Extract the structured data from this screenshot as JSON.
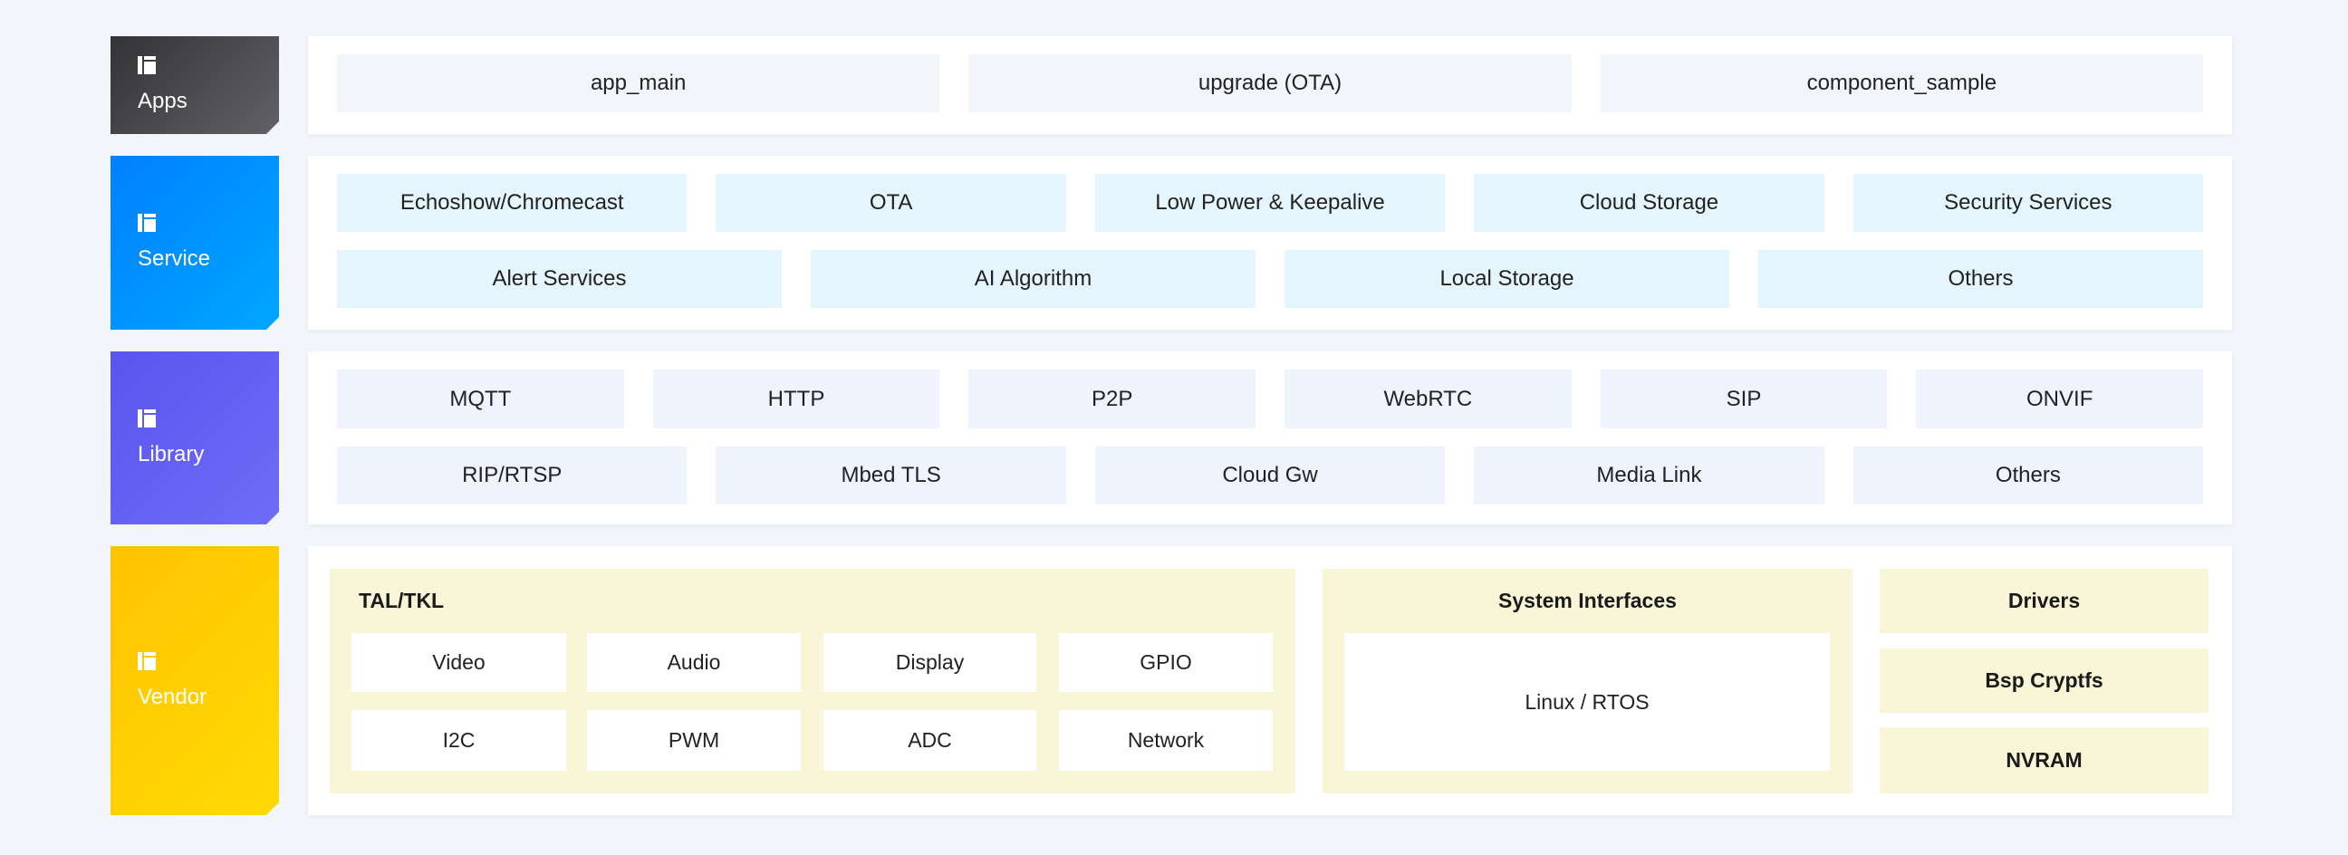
{
  "layers": [
    {
      "label": "Apps",
      "icon": "layout-icon",
      "color_start": "#333336",
      "color_end": "#626266"
    },
    {
      "label": "Service",
      "icon": "layout-icon",
      "color_start": "#0080ff",
      "color_end": "#00a6ff"
    },
    {
      "label": "Library",
      "icon": "layout-icon",
      "color_start": "#5a55ee",
      "color_end": "#6f6cf7"
    },
    {
      "label": "Vendor",
      "icon": "layout-icon",
      "color_start": "#ffc300",
      "color_end": "#ffda06"
    }
  ],
  "apps": [
    "app_main",
    "upgrade (OTA)",
    "component_sample"
  ],
  "service": {
    "row1": [
      "Echoshow/Chromecast",
      "OTA",
      "Low Power & Keepalive",
      "Cloud Storage",
      "Security Services"
    ],
    "row2": [
      "Alert Services",
      "AI Algorithm",
      "Local Storage",
      "Others"
    ]
  },
  "library": {
    "row1": [
      "MQTT",
      "HTTP",
      "P2P",
      "WebRTC",
      "SIP",
      "ONVIF"
    ],
    "row2": [
      "RIP/RTSP",
      "Mbed TLS",
      "Cloud Gw",
      "Media Link",
      "Others"
    ]
  },
  "vendor": {
    "tal": {
      "title": "TAL/TKL",
      "items": [
        "Video",
        "Audio",
        "Display",
        "GPIO",
        "I2C",
        "PWM",
        "ADC",
        "Network"
      ]
    },
    "system": {
      "title": "System Interfaces",
      "content": "Linux / RTOS"
    },
    "side": [
      "Drivers",
      "Bsp Cryptfs",
      "NVRAM"
    ]
  }
}
